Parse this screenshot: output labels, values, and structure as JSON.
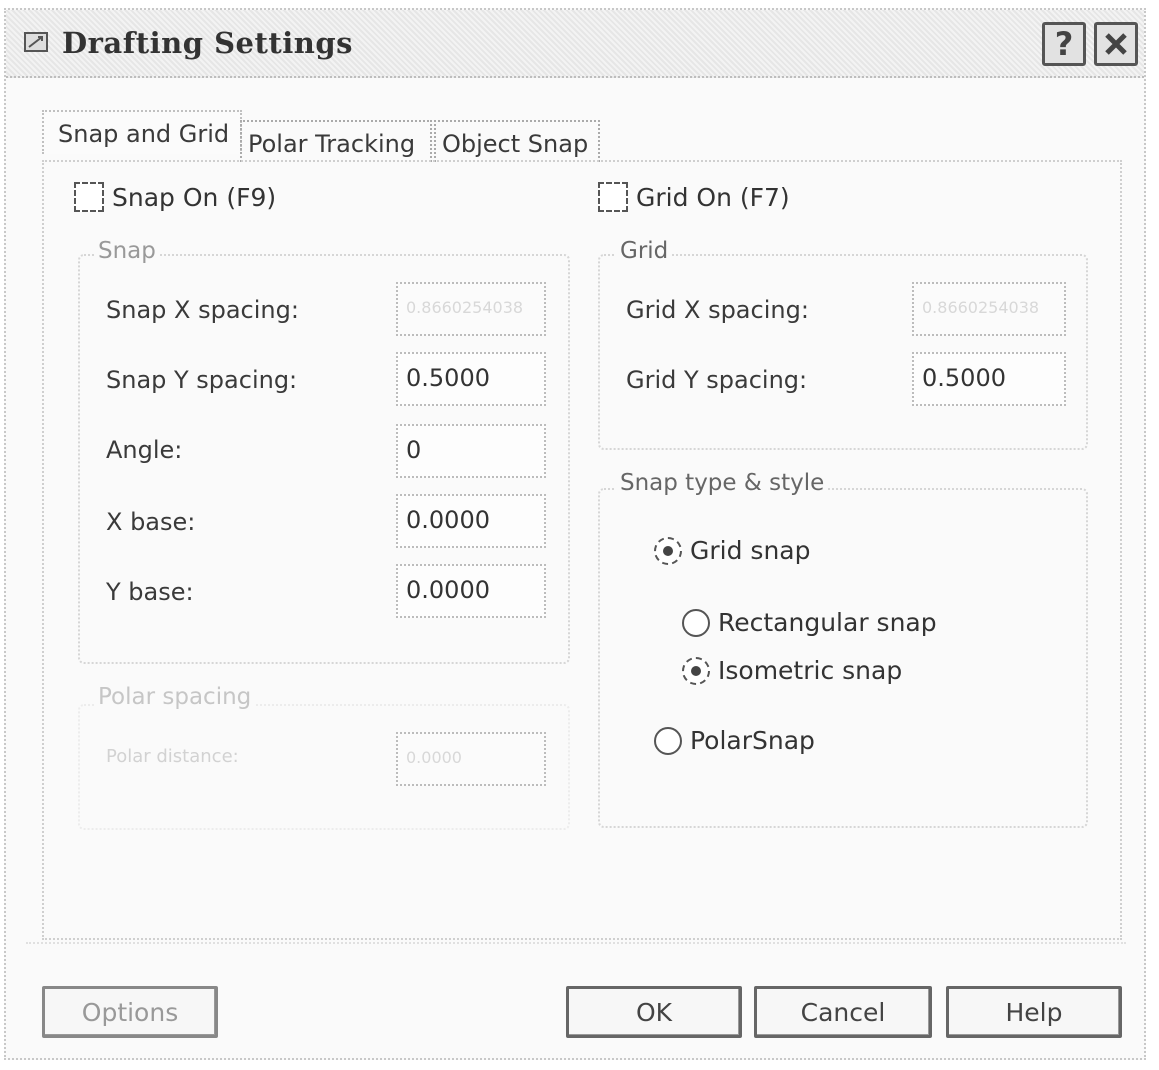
{
  "window": {
    "title": "Drafting Settings",
    "help_button": "?",
    "close_button": "✕"
  },
  "tabs": [
    {
      "label": "Snap and Grid",
      "active": true
    },
    {
      "label": "Polar Tracking",
      "active": false
    },
    {
      "label": "Object Snap",
      "active": false
    }
  ],
  "snap_on": {
    "label": "Snap On (F9)",
    "checked": false
  },
  "grid_on": {
    "label": "Grid On (F7)",
    "checked": false
  },
  "snap_group": {
    "title": "Snap",
    "x_spacing_label": "Snap X spacing:",
    "x_spacing_value": "0.8660254038",
    "y_spacing_label": "Snap Y spacing:",
    "y_spacing_value": "0.5000",
    "angle_label": "Angle:",
    "angle_value": "0",
    "x_base_label": "X base:",
    "x_base_value": "0.0000",
    "y_base_label": "Y base:",
    "y_base_value": "0.0000"
  },
  "polar_group": {
    "title": "Polar spacing",
    "distance_label": "Polar distance:",
    "distance_value": "0.0000"
  },
  "grid_group": {
    "title": "Grid",
    "x_spacing_label": "Grid X spacing:",
    "x_spacing_value": "0.8660254038",
    "y_spacing_label": "Grid Y spacing:",
    "y_spacing_value": "0.5000"
  },
  "snap_type_group": {
    "title": "Snap type & style",
    "grid_snap": {
      "label": "Grid snap",
      "selected": true
    },
    "rectangular_snap": {
      "label": "Rectangular snap",
      "selected": false
    },
    "isometric_snap": {
      "label": "Isometric snap",
      "selected": true
    },
    "polar_snap": {
      "label": "PolarSnap",
      "selected": false
    }
  },
  "buttons": {
    "options": "Options",
    "ok": "OK",
    "cancel": "Cancel",
    "help": "Help"
  }
}
